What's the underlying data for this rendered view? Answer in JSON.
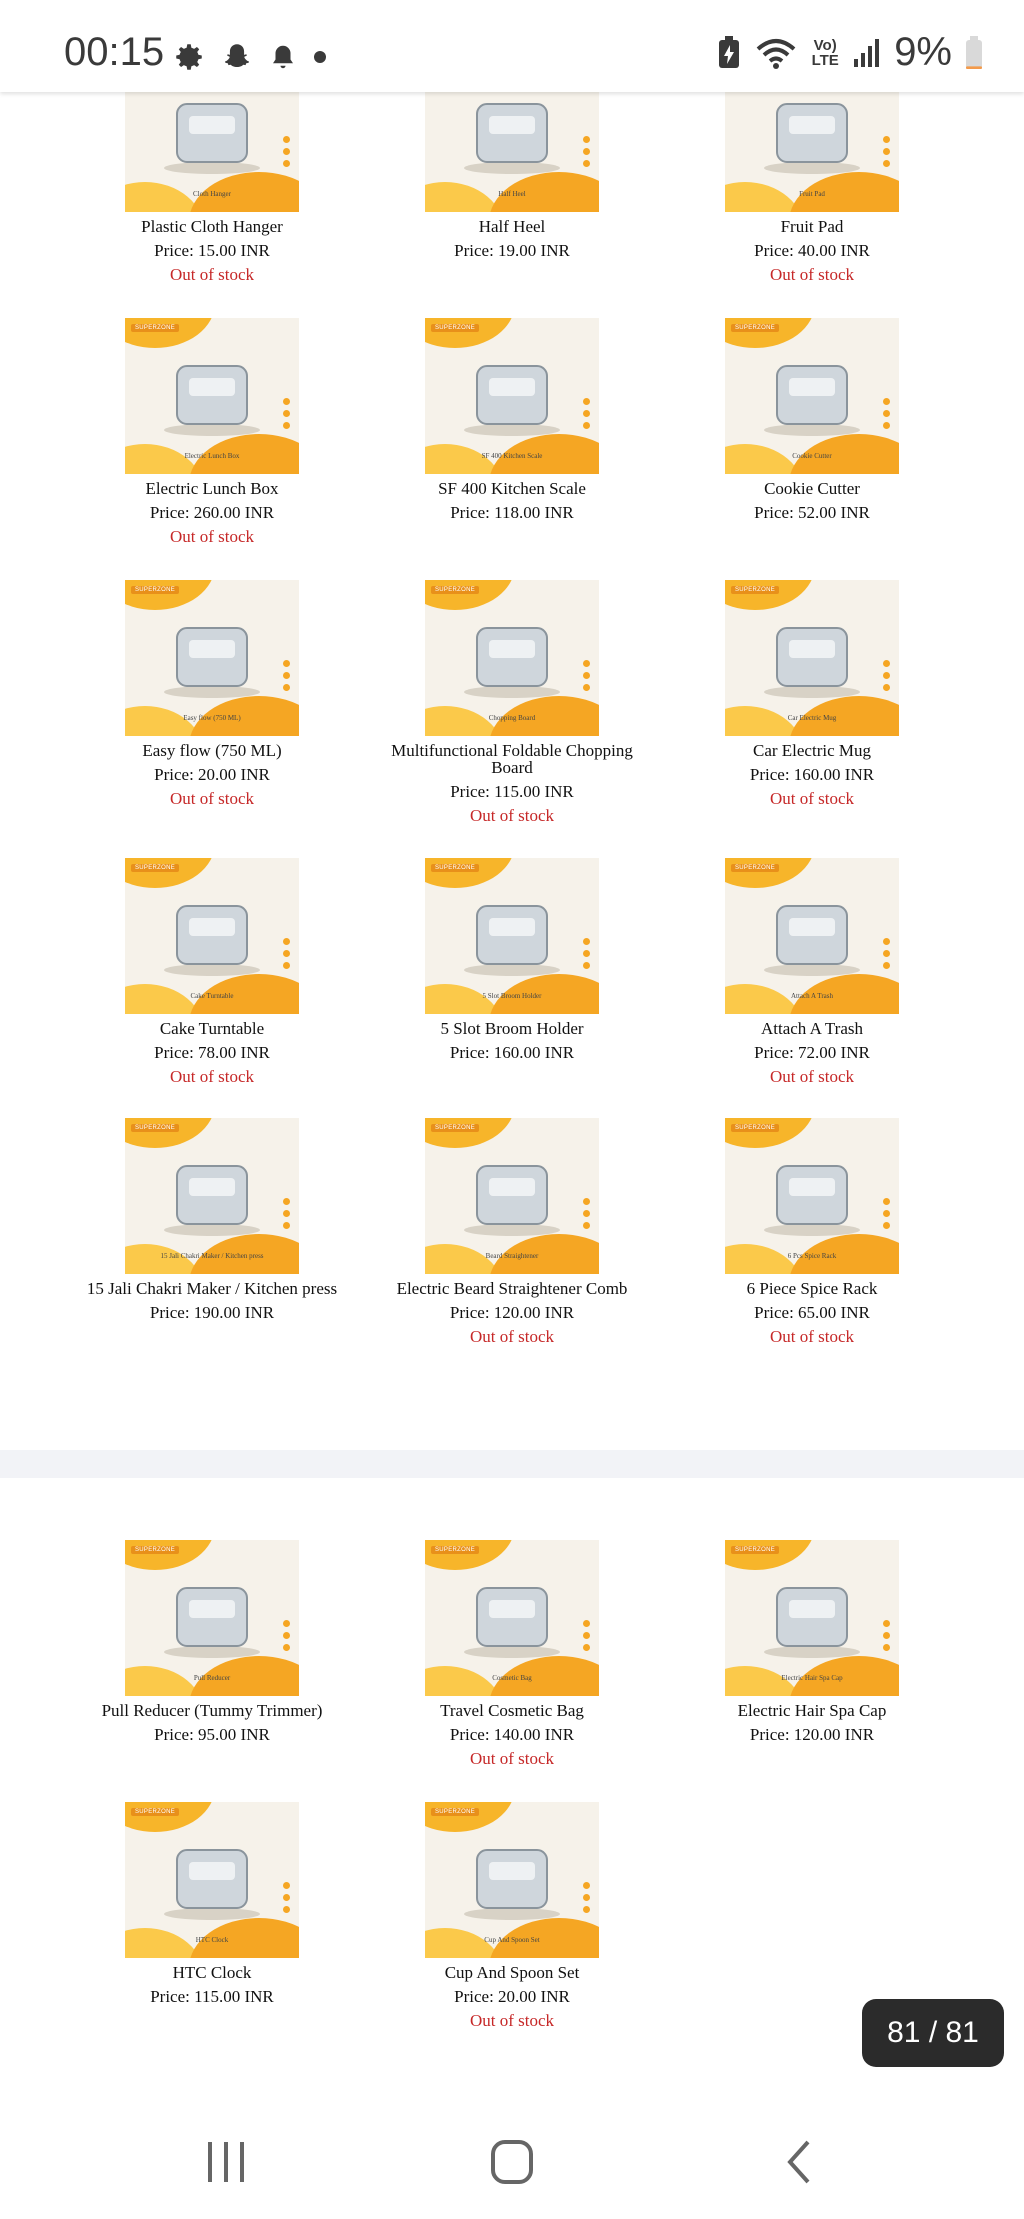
{
  "status_bar": {
    "time": "00:15",
    "left_icons": [
      "gear-icon",
      "snapchat-icon",
      "bell-icon",
      "dot-icon"
    ],
    "right_icons": [
      "battery-saver-icon",
      "wifi-icon",
      "volte-icon",
      "signal-icon"
    ],
    "volte_label": "Vo) LTE",
    "battery_percent": "9%",
    "battery_level": 0.09
  },
  "products_section_1": [
    {
      "name": "Plastic Cloth Hanger",
      "price": "Price: 15.00 INR",
      "stock": "Out of stock",
      "caption": "Cloth Hanger"
    },
    {
      "name": "Half Heel",
      "price": "Price: 19.00 INR",
      "stock": "",
      "caption": "Half Heel"
    },
    {
      "name": "Fruit Pad",
      "price": "Price: 40.00 INR",
      "stock": "Out of stock",
      "caption": "Fruit Pad"
    },
    {
      "name": "Electric Lunch Box",
      "price": "Price: 260.00 INR",
      "stock": "Out of stock",
      "caption": "Electric Lunch Box"
    },
    {
      "name": "SF 400 Kitchen Scale",
      "price": "Price: 118.00 INR",
      "stock": "",
      "caption": "SF 400 Kitchen Scale"
    },
    {
      "name": "Cookie Cutter",
      "price": "Price: 52.00 INR",
      "stock": "",
      "caption": "Cookie Cutter"
    },
    {
      "name": "Easy flow (750 ML)",
      "price": "Price: 20.00 INR",
      "stock": "Out of stock",
      "caption": "Easy flow (750 ML)"
    },
    {
      "name": "Multifunctional Foldable Chopping Board",
      "price": "Price: 115.00 INR",
      "stock": "Out of stock",
      "caption": "Chopping Board"
    },
    {
      "name": "Car Electric Mug",
      "price": "Price: 160.00 INR",
      "stock": "Out of stock",
      "caption": "Car Electric Mug"
    },
    {
      "name": "Cake Turntable",
      "price": "Price: 78.00 INR",
      "stock": "Out of stock",
      "caption": "Cake Turntable"
    },
    {
      "name": "5 Slot Broom Holder",
      "price": "Price: 160.00 INR",
      "stock": "",
      "caption": "5 Slot Broom Holder"
    },
    {
      "name": "Attach A Trash",
      "price": "Price: 72.00 INR",
      "stock": "Out of stock",
      "caption": "Attach A Trash"
    },
    {
      "name": "15 Jali Chakri Maker / Kitchen press",
      "price": "Price: 190.00 INR",
      "stock": "",
      "caption": "15 Jali Chakri Maker / Kitchen press"
    },
    {
      "name": "Electric Beard Straightener Comb",
      "price": "Price: 120.00 INR",
      "stock": "Out of stock",
      "caption": "Beard Straightener"
    },
    {
      "name": "6 Piece Spice Rack",
      "price": "Price: 65.00 INR",
      "stock": "Out of stock",
      "caption": "6 Pcs Spice Rack"
    }
  ],
  "products_section_2": [
    {
      "name": "Pull Reducer (Tummy Trimmer)",
      "price": "Price: 95.00 INR",
      "stock": "",
      "caption": "Pull Reducer"
    },
    {
      "name": "Travel Cosmetic Bag",
      "price": "Price: 140.00 INR",
      "stock": "Out of stock",
      "caption": "Cosmetic Bag"
    },
    {
      "name": "Electric Hair Spa Cap",
      "price": "Price: 120.00 INR",
      "stock": "",
      "caption": "Electric Hair Spa Cap"
    },
    {
      "name": "HTC Clock",
      "price": "Price: 115.00 INR",
      "stock": "",
      "caption": "HTC Clock"
    },
    {
      "name": "Cup And Spoon Set",
      "price": "Price: 20.00 INR",
      "stock": "Out of stock",
      "caption": "Cup And Spoon Set"
    }
  ],
  "page_counter": "81 / 81",
  "nav_bar": {
    "buttons": [
      "recents-icon",
      "home-icon",
      "back-icon"
    ]
  },
  "colors": {
    "out_of_stock": "#c62828",
    "thumb_accent": "#f5a623"
  }
}
